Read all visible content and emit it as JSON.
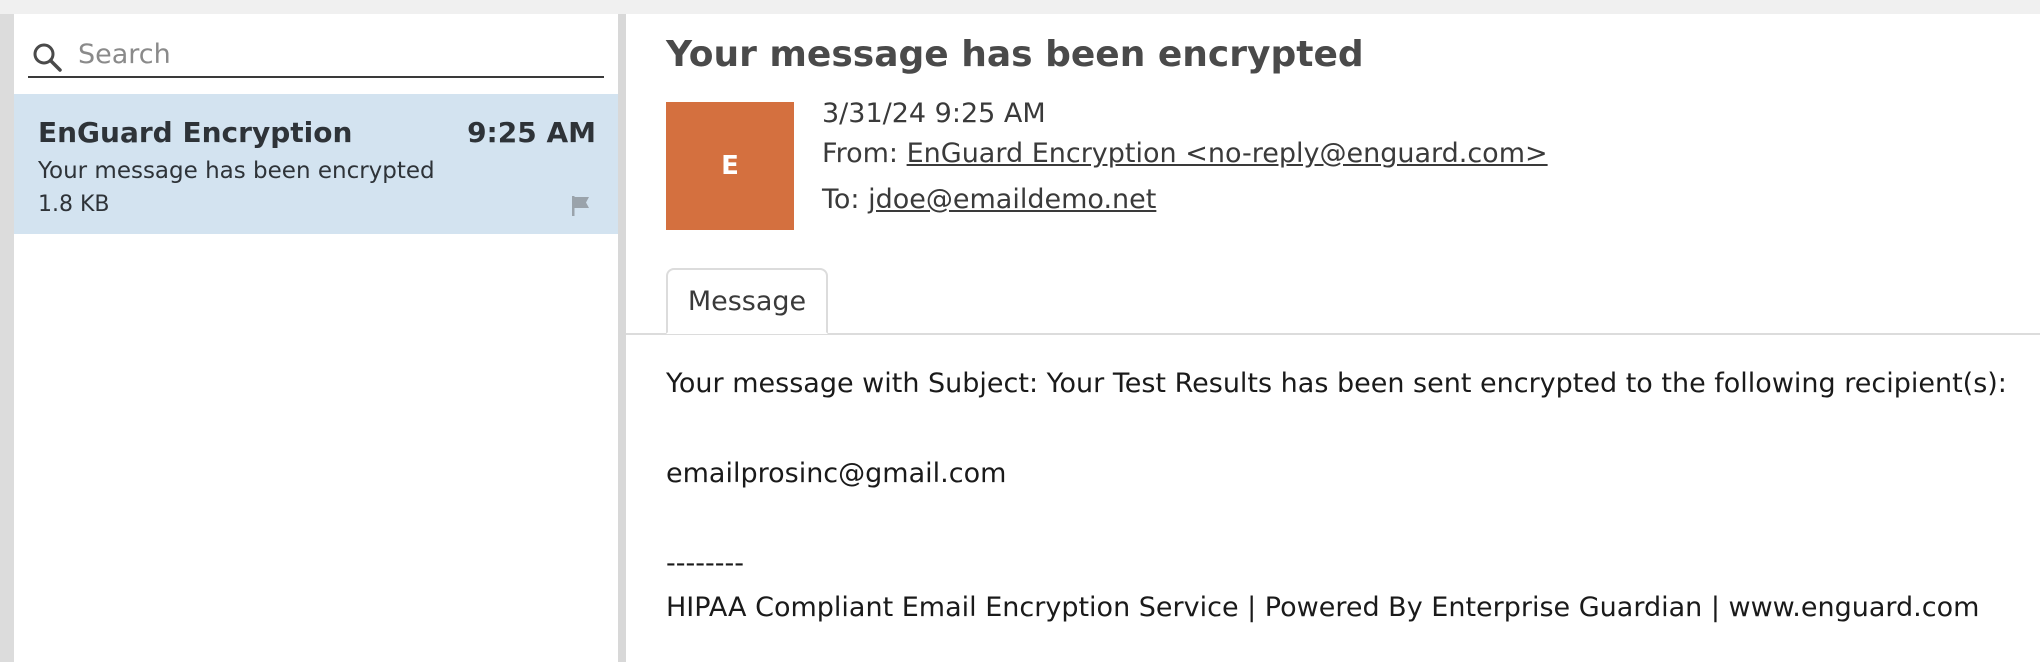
{
  "search": {
    "placeholder": "Search"
  },
  "message_list": {
    "items": [
      {
        "sender": "EnGuard Encryption",
        "time": "9:25 AM",
        "subject": "Your message has been encrypted",
        "size": "1.8 KB",
        "flag_icon": "flag-icon"
      }
    ],
    "selected_bg": "#d3e3f0"
  },
  "reader": {
    "subject": "Your message has been encrypted",
    "avatar_letter": "E",
    "avatar_color": "#d4703f",
    "date": "3/31/24 9:25 AM",
    "from_label": "From:",
    "from_value": "EnGuard Encryption <no-reply@enguard.com>",
    "to_label": "To:",
    "to_value": "jdoe@emaildemo.net",
    "tabs": [
      {
        "label": "Message"
      }
    ],
    "body": {
      "line1": "Your message with Subject: Your Test Results has been sent encrypted to the following recipient(s):",
      "line2": "emailprosinc@gmail.com",
      "line3": "--------",
      "line4": "HIPAA Compliant Email Encryption Service | Powered By Enterprise Guardian | www.enguard.com"
    }
  }
}
